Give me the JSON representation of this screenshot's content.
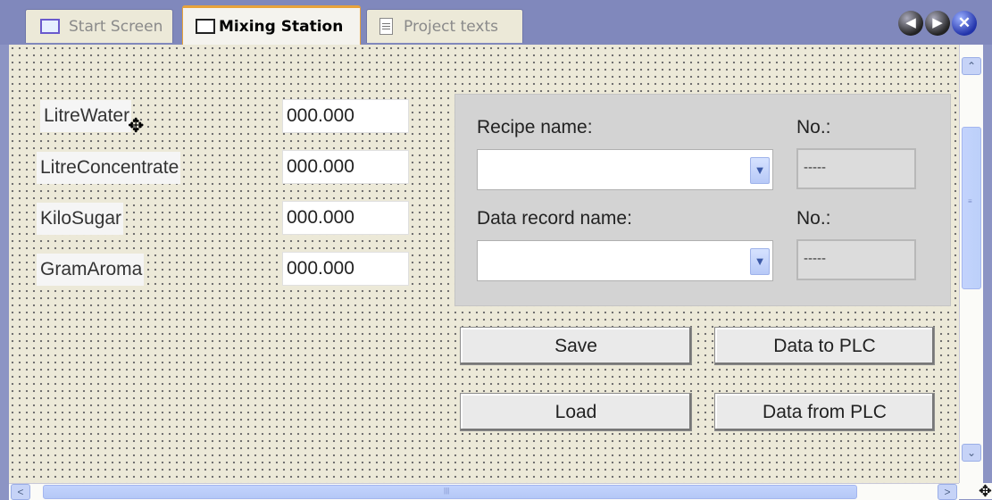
{
  "tabs": [
    {
      "label": "Start Screen",
      "icon": "screen-icon"
    },
    {
      "label": "Mixing Station",
      "icon": "screen-icon",
      "active": true
    },
    {
      "label": "Project texts",
      "icon": "text-document-icon"
    }
  ],
  "nav": {
    "prev_glyph": "◀",
    "next_glyph": "▶",
    "close_glyph": "✕"
  },
  "fields": [
    {
      "label": "LitreWater",
      "value": "000.000"
    },
    {
      "label": "LitreConcentrate",
      "value": "000.000"
    },
    {
      "label": "KiloSugar",
      "value": "000.000"
    },
    {
      "label": "GramAroma",
      "value": "000.000"
    }
  ],
  "recipe_view": {
    "recipe_name_label": "Recipe name:",
    "recipe_no_label": "No.:",
    "recipe_no_value": "-----",
    "record_name_label": "Data record name:",
    "record_no_label": "No.:",
    "record_no_value": "-----"
  },
  "buttons": {
    "save": "Save",
    "load": "Load",
    "to_plc": "Data to PLC",
    "from_plc": "Data from PLC"
  },
  "scrollbars": {
    "up": "⌃",
    "down": "⌄",
    "left": "<",
    "right": ">",
    "grip_v": "≡",
    "grip_h": "|||",
    "corner": "✥"
  },
  "colors": {
    "active_tab_accent": "#e8a33c",
    "tabbar_bg": "#8088bc",
    "canvas_bg": "#ece9d8",
    "scrollbar_thumb": "#c3d3fd"
  }
}
